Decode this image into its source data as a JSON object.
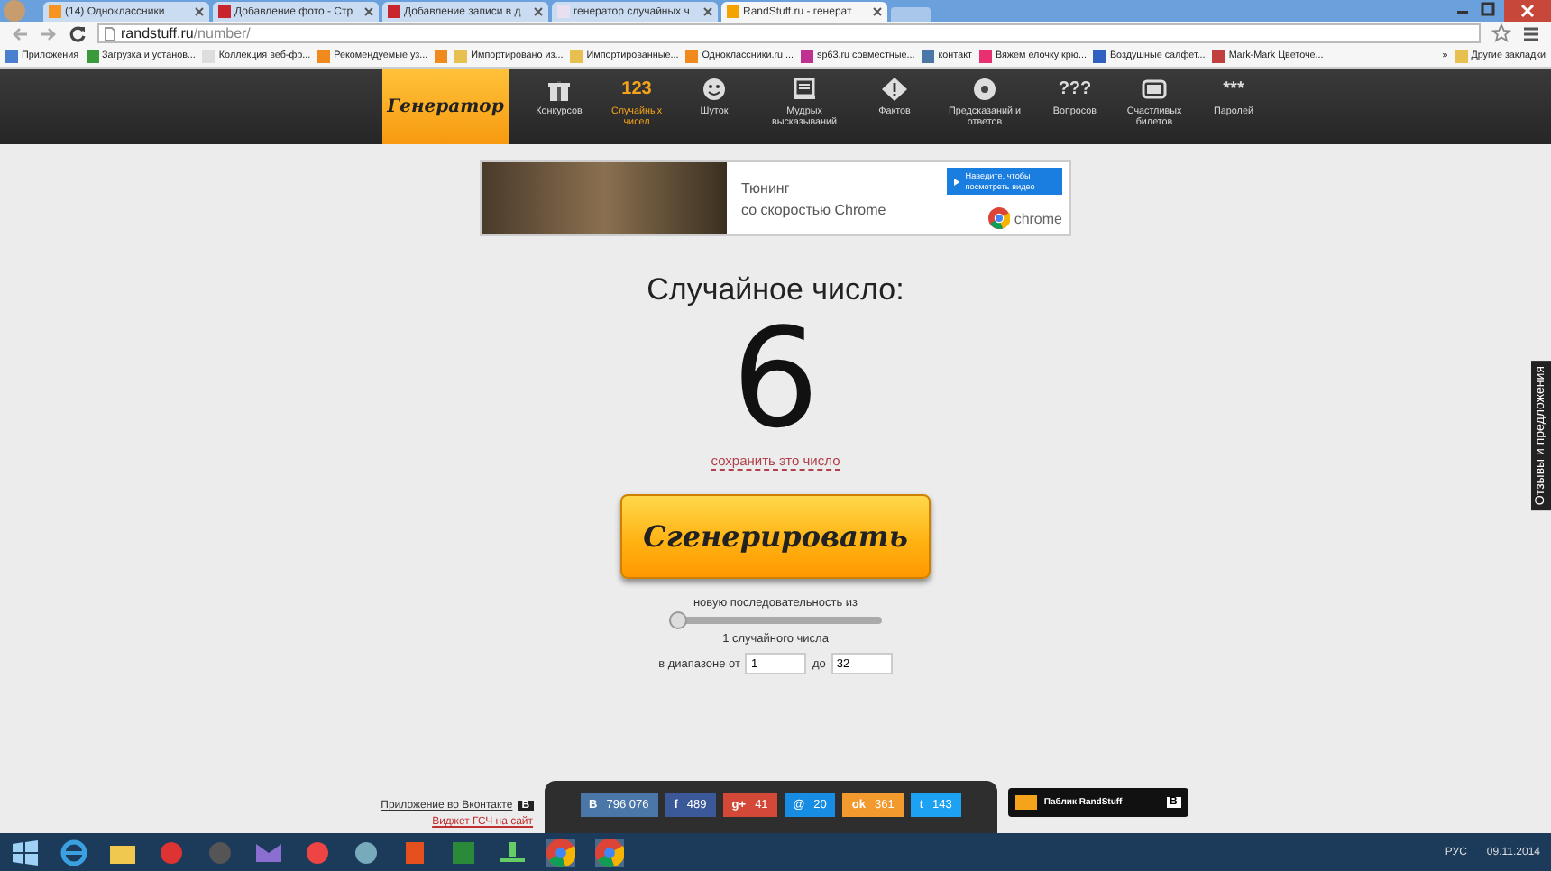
{
  "browser": {
    "tabs": [
      {
        "label": "(14) Одноклассники",
        "selected": false,
        "color": "#f7931e"
      },
      {
        "label": "Добавление фото - Стр",
        "selected": false,
        "color": "#c8262c"
      },
      {
        "label": "Добавление записи в д",
        "selected": false,
        "color": "#c8262c"
      },
      {
        "label": "генератор случайных ч",
        "selected": false,
        "color": "#e8e0f0"
      },
      {
        "label": "RandStuff.ru - генерат",
        "selected": true,
        "color": "#f5a300"
      }
    ],
    "address": {
      "host": "randstuff.ru",
      "path": "/number/"
    },
    "bookmarks": [
      {
        "label": "Приложения",
        "color": "#4a7fd0"
      },
      {
        "label": "Загрузка и установ...",
        "color": "#3a9a3a"
      },
      {
        "label": "Коллекция веб-фр...",
        "color": "#dddddd"
      },
      {
        "label": "Рекомендуемые уз...",
        "color": "#f08a1c"
      },
      {
        "color": "#f08a1c"
      },
      {
        "label": "Импортировано из...",
        "color": "#e8c050"
      },
      {
        "label": "Импортированные...",
        "color": "#e8c050"
      },
      {
        "label": "Одноклассники.ru ...",
        "color": "#f08a1c"
      },
      {
        "label": "sp63.ru совместные...",
        "color": "#c03090"
      },
      {
        "label": "контакт",
        "color": "#4a76a8"
      },
      {
        "label": "Вяжем елочку крю...",
        "color": "#e83070"
      },
      {
        "label": "Воздушные салфет...",
        "color": "#3060c0"
      },
      {
        "label": "Mark-Mark Цветоче...",
        "color": "#c04040"
      }
    ],
    "more": "»",
    "other": "Другие закладки"
  },
  "site": {
    "logo": "Генератор",
    "nav": [
      {
        "label": "Конкурсов",
        "selected": false
      },
      {
        "label": "Случайных чисел",
        "selected": true,
        "glyph": "123"
      },
      {
        "label": "Шуток",
        "selected": false
      },
      {
        "label": "Мудрых высказываний",
        "selected": false
      },
      {
        "label": "Фактов",
        "selected": false
      },
      {
        "label": "Предсказаний и ответов",
        "selected": false
      },
      {
        "label": "Вопросов",
        "selected": false,
        "glyph": "???"
      },
      {
        "label": "Счастливых билетов",
        "selected": false
      },
      {
        "label": "Паролей",
        "selected": false,
        "glyph": "***"
      }
    ],
    "ad": {
      "line1": "Тюнинг",
      "line2": "со скоростью Chrome",
      "button": "Наведите, чтобы посмотреть видео",
      "brand": "chrome"
    },
    "heading": "Случайное число:",
    "number": "6",
    "save_link": "сохранить это число",
    "generate": "Сгенерировать",
    "sequence_label": "новую последовательность из",
    "slider": {
      "level": 0
    },
    "count_label": "1 случайного числа",
    "range": {
      "from_label": "в диапазоне от",
      "from": "1",
      "to_label": "до",
      "to": "32"
    },
    "feedback": "Отзывы и предложения",
    "footer": {
      "vk_app": "Приложение во Вконтакте",
      "vk_badge": "В",
      "widget": "Виджет ГСЧ на сайт",
      "shares": [
        {
          "glyph": "В",
          "count": "796 076",
          "color": "#4a76a8"
        },
        {
          "glyph": "f",
          "count": "489",
          "color": "#3b5998"
        },
        {
          "glyph": "g+",
          "count": "41",
          "color": "#d34836"
        },
        {
          "glyph": "@",
          "count": "20",
          "color": "#168de2"
        },
        {
          "glyph": "ok",
          "count": "361",
          "color": "#f39a2e"
        },
        {
          "glyph": "t",
          "count": "143",
          "color": "#1da1f2"
        }
      ],
      "public": "Паблик RandStuff",
      "public_badge": "В"
    }
  },
  "taskbar": {
    "lang": "РУС",
    "date": "09.11.2014"
  }
}
